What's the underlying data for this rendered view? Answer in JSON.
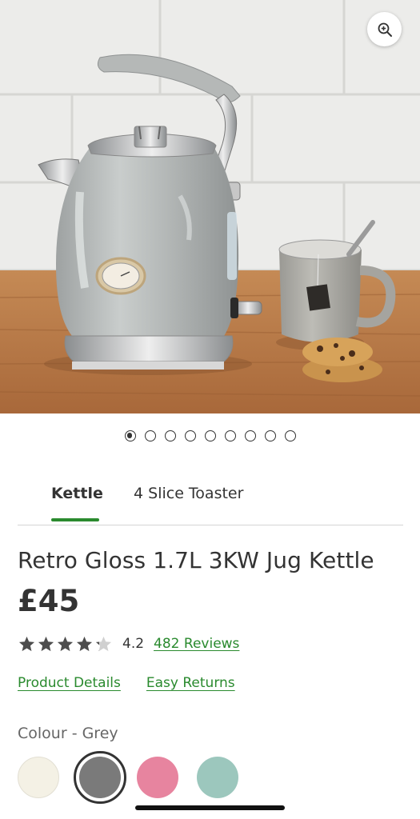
{
  "gallery": {
    "zoom_icon": "zoom-in-icon",
    "image_count": 9,
    "active_index": 0
  },
  "tabs": [
    {
      "label": "Kettle",
      "active": true
    },
    {
      "label": "4 Slice Toaster",
      "active": false
    }
  ],
  "product": {
    "title": "Retro Gloss 1.7L 3KW Jug Kettle",
    "price": "£45",
    "rating": "4.2",
    "rating_value": 4.2,
    "rating_max": 5,
    "reviews_link": "482 Reviews",
    "details_link": "Product Details",
    "returns_link": "Easy Returns"
  },
  "colour": {
    "label": "Colour - Grey",
    "options": [
      {
        "color": "#f4f1e5",
        "selected": false
      },
      {
        "color": "#7a7a7a",
        "selected": true
      },
      {
        "color": "#e7849f",
        "selected": false
      },
      {
        "color": "#9cc7bd",
        "selected": false
      }
    ]
  },
  "theme": {
    "accent": "#2a8a2e",
    "text": "#333333"
  }
}
